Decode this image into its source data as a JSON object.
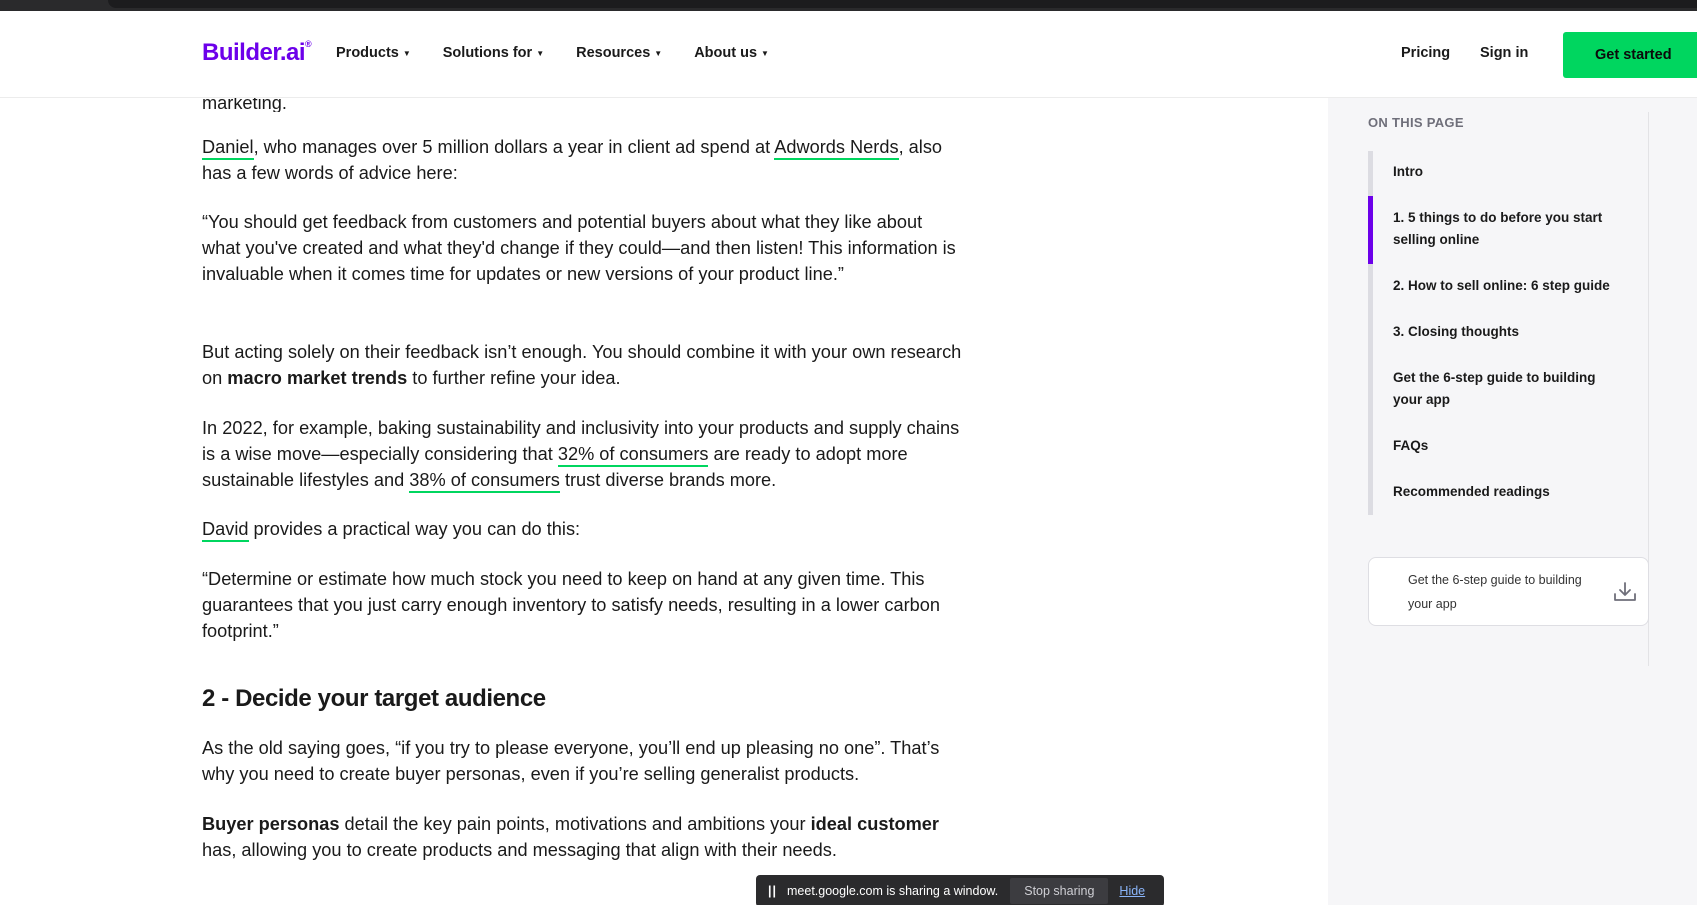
{
  "header": {
    "logo_text": "Builder.ai",
    "logo_mark": "®",
    "nav": [
      {
        "label": "Products"
      },
      {
        "label": "Solutions for"
      },
      {
        "label": "Resources"
      },
      {
        "label": "About us"
      }
    ],
    "pricing_label": "Pricing",
    "signin_label": "Sign in",
    "cta_label": "Get started"
  },
  "article": {
    "clipped_text": "marketing.",
    "p1": {
      "link1": "Daniel",
      "t1": ", who manages over 5 million dollars a year in client ad spend at ",
      "link2": "Adwords Nerds",
      "t2": ", also has a few words of advice here:"
    },
    "p2": "“You should get feedback from customers and potential buyers about what they like about what you've created and what they'd change if they could—and then listen! This information is invaluable when it comes time for updates or new versions of your product line.”",
    "p3": {
      "t1": "But acting solely on their feedback isn’t enough. You should combine it with your own research on ",
      "bold": "macro market trends",
      "t2": " to further refine your idea."
    },
    "p4": {
      "t1": "In 2022, for example, baking sustainability and inclusivity into your products and supply chains is a wise move—especially considering that ",
      "link1": "32% of consumers",
      "t2": " are ready to adopt more sustainable lifestyles and ",
      "link2": "38% of consumers",
      "t3": " trust diverse brands more."
    },
    "p5": {
      "link": "David",
      "t1": " provides a practical way you can do this:"
    },
    "p6": "“Determine or estimate how much stock you need to keep on hand at any given time. This guarantees that you just carry enough inventory to satisfy needs, resulting in a lower carbon footprint.”",
    "h2": "2 - Decide your target audience",
    "p7": "As the old saying goes, “if you try to please everyone, you’ll end up pleasing no one”. That’s why you need to create buyer personas, even if you’re selling generalist products.",
    "p8": {
      "bold1": "Buyer personas",
      "t1": " detail the key pain points, motivations and ambitions your ",
      "bold2": "ideal customer",
      "t2": " has, allowing you to create products and messaging that align with their needs."
    }
  },
  "sidebar": {
    "title": "ON THIS PAGE",
    "items": [
      {
        "label": "Intro"
      },
      {
        "label": "1. 5 things to do before you start selling online"
      },
      {
        "label": "2. How to sell online: 6 step guide"
      },
      {
        "label": "3. Closing thoughts"
      },
      {
        "label": "Get the 6-step guide to building your app"
      },
      {
        "label": "FAQs"
      },
      {
        "label": "Recommended readings"
      }
    ],
    "download_card": {
      "label": "Get the 6-step guide to building your app",
      "icon": "download-icon"
    }
  },
  "sharebar": {
    "pause_glyph": "||",
    "message": "meet.google.com is sharing a window.",
    "stop_label": "Stop sharing",
    "hide_label": "Hide"
  },
  "colors": {
    "brand": "#6c00ea",
    "accent_green": "#00d65f"
  }
}
